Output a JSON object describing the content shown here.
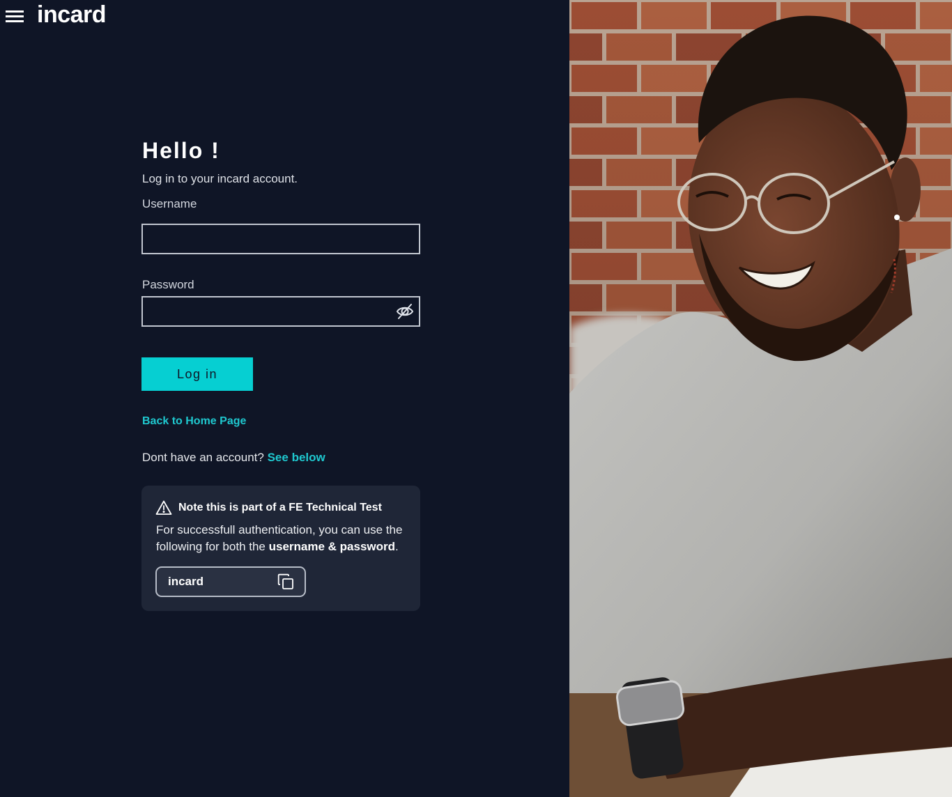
{
  "header": {
    "menu_icon": "hamburger-icon",
    "logo_text": "incard"
  },
  "login": {
    "title": "Hello !",
    "subtitle": "Log in to your incard account.",
    "username_label": "Username",
    "username_value": "",
    "password_label": "Password",
    "password_value": "",
    "password_toggle_icon": "eye-slash-icon",
    "submit_label": "Log in",
    "back_link": "Back to Home Page",
    "signup_prompt": "Dont have an account?",
    "signup_link": "See below"
  },
  "note": {
    "icon": "warning-triangle-icon",
    "title": "Note this is part of a FE Technical Test",
    "text_before": "For successfull authentication, you can use the following for both the ",
    "text_bold": "username & password",
    "text_after": ".",
    "credential_value": "incard",
    "copy_icon": "copy-icon"
  },
  "colors": {
    "background": "#0f1526",
    "accent": "#06cfd2",
    "link": "#1fc8cf",
    "card": "#1f2637",
    "chip": "#2a3142",
    "border": "#c2c7d0",
    "text": "#ffffff"
  }
}
